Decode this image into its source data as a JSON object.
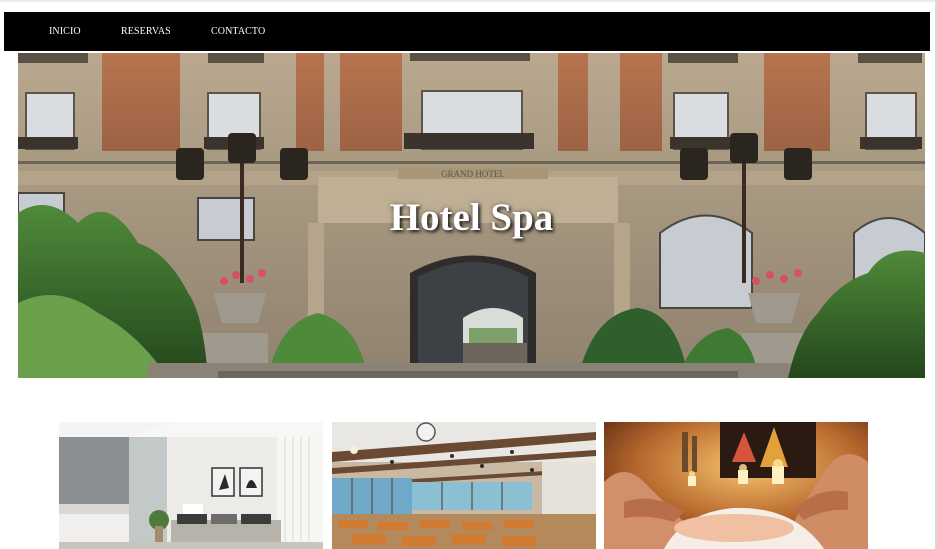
{
  "nav": {
    "items": [
      {
        "label": "INICIO"
      },
      {
        "label": "RESERVAS"
      },
      {
        "label": "CONTACTO"
      }
    ]
  },
  "hero": {
    "title": "Hotel Spa",
    "building_sign": "GRAND HOTEL"
  },
  "cards": [
    {
      "subject": "bedroom"
    },
    {
      "subject": "restaurant"
    },
    {
      "subject": "spa-massage"
    }
  ],
  "colors": {
    "navbar_bg": "#000000",
    "nav_text": "#ffffff",
    "hero_title": "#ffffff",
    "page_bg": "#ffffff"
  }
}
